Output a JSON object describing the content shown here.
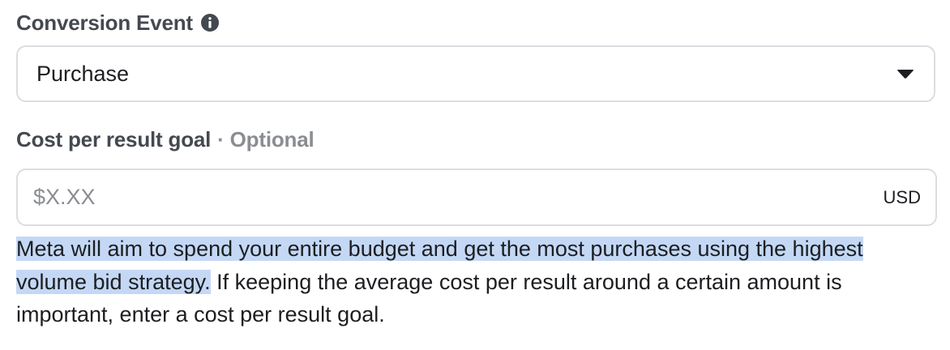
{
  "conversion_event": {
    "label": "Conversion Event",
    "info_icon": "info-circle-icon",
    "selected_value": "Purchase",
    "dropdown_icon": "caret-down-icon"
  },
  "cost_goal": {
    "label": "Cost per result goal",
    "optional_suffix": "· Optional",
    "placeholder": "$X.XX",
    "value": "",
    "currency": "USD"
  },
  "help": {
    "highlighted_text": "Meta will aim to spend your entire budget and get the most purchases using the highest volume bid strategy.",
    "rest_text": " If keeping the average cost per result around a certain amount is important, enter a cost per result goal."
  },
  "colors": {
    "label": "#444950",
    "muted": "#8a8d91",
    "border": "#dadde1",
    "selection_highlight": "#c4d8f5",
    "text": "#1c1e21"
  }
}
